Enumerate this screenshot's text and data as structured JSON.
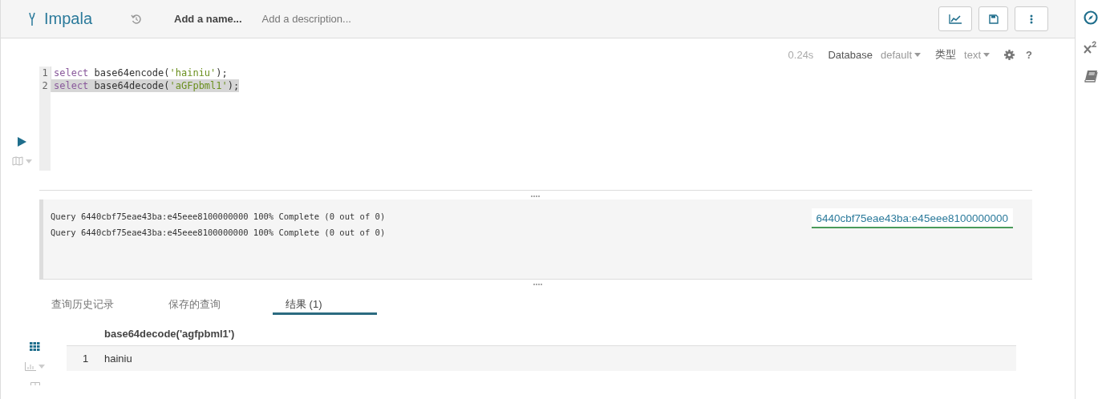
{
  "header": {
    "title": "Impala",
    "name_placeholder": "Add a name...",
    "description_placeholder": "Add a description..."
  },
  "editor_toolbar": {
    "duration": "0.24s",
    "database_label": "Database",
    "database_value": "default",
    "type_label": "类型",
    "type_value": "text",
    "help": "?"
  },
  "code_lines": [
    {
      "number": "1",
      "selected": false,
      "tokens": [
        {
          "kind": "keyword",
          "text": "select"
        },
        {
          "kind": "plain",
          "text": " base64encode("
        },
        {
          "kind": "string",
          "text": "'hainiu'"
        },
        {
          "kind": "plain",
          "text": ");"
        }
      ]
    },
    {
      "number": "2",
      "selected": true,
      "tokens": [
        {
          "kind": "keyword",
          "text": "select"
        },
        {
          "kind": "plain",
          "text": " base64decode("
        },
        {
          "kind": "string",
          "text": "'aGFpbml1'"
        },
        {
          "kind": "plain",
          "text": ");"
        }
      ]
    }
  ],
  "log": {
    "lines": [
      "Query 6440cbf75eae43ba:e45eee8100000000 100% Complete (0 out of 0)",
      "Query 6440cbf75eae43ba:e45eee8100000000 100% Complete (0 out of 0)"
    ],
    "query_link": "6440cbf75eae43ba:e45eee8100000000"
  },
  "tabs": [
    {
      "label": "查询历史记录",
      "selected": false
    },
    {
      "label": "保存的查询",
      "selected": false
    },
    {
      "label": "结果 (1)",
      "selected": true
    }
  ],
  "result_views": [
    {
      "kind": "grid",
      "selected": true
    },
    {
      "kind": "chart",
      "selected": false
    }
  ],
  "table": {
    "columns": [
      "base64decode('agfpbml1')"
    ],
    "rows": [
      {
        "index": "1",
        "cells": [
          "hainiu"
        ]
      }
    ]
  },
  "right_sidebar": [
    {
      "kind": "compass",
      "selected": true
    },
    {
      "kind": "formula",
      "selected": false
    },
    {
      "kind": "book",
      "selected": false
    }
  ]
}
